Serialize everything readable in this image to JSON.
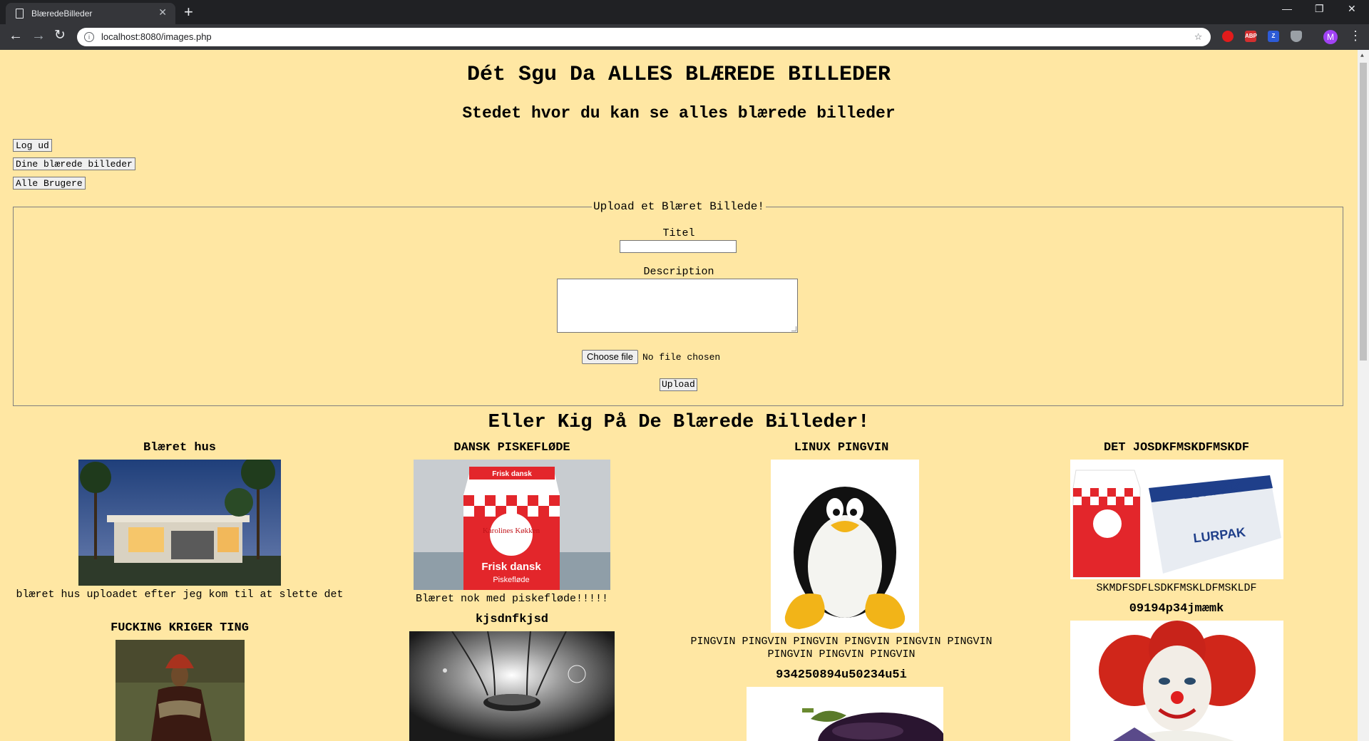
{
  "browser": {
    "tab_title": "BlæredeBilleder",
    "url": "localhost:8080/images.php",
    "profile_initial": "M",
    "extensions": [
      "ABP",
      "Z"
    ]
  },
  "page": {
    "heading": "Dét Sgu Da ALLES BLÆREDE BILLEDER",
    "subheading": "Stedet hvor du kan se alles blærede billeder",
    "nav_buttons": [
      "Log ud",
      "Dine blærede billeder",
      "Alle Brugere"
    ],
    "upload_form": {
      "legend": "Upload et Blæret Billede!",
      "title_label": "Titel",
      "title_value": "",
      "description_label": "Description",
      "description_value": "",
      "file_button": "Choose file",
      "file_status": "No file chosen",
      "submit_label": "Upload"
    },
    "gallery_heading": "Eller Kig På De Blærede Billeder!",
    "images": [
      {
        "title": "Blæret hus",
        "description": "blæret hus uploadet efter jeg kom til at slette det",
        "picture": "modern-house-photo"
      },
      {
        "title": "DANSK PISKEFLØDE",
        "description": "Blæret nok med piskefløde!!!!!",
        "picture": "cream-carton-photo",
        "carton_brand": "Karolines Køkken",
        "carton_label": "Frisk dansk",
        "carton_sub": "Piskefløde"
      },
      {
        "title": "LINUX PINGVIN",
        "description": "PINGVIN PINGVIN PINGVIN PINGVIN PINGVIN PINGVIN PINGVIN PINGVIN PINGVIN",
        "picture": "tux-penguin"
      },
      {
        "title": "DET JOSDKFMSKDFMSKDF",
        "description": "SKMDFSDFLSDKFMSKLDFMSKLDF",
        "picture": "cream-and-butter-photo",
        "butter_brand": "LURPAK"
      },
      {
        "title": "FUCKING KRIGER TING",
        "description": "",
        "picture": "warrior-photo"
      },
      {
        "title": "kjsdnfkjsd",
        "description": "",
        "picture": "sci-fi-photo"
      },
      {
        "title": "934250894u50234u5i",
        "description": "",
        "picture": "eggplant-photo"
      },
      {
        "title": "09194p34jmæmk",
        "description": "",
        "picture": "clown-photo"
      }
    ]
  }
}
